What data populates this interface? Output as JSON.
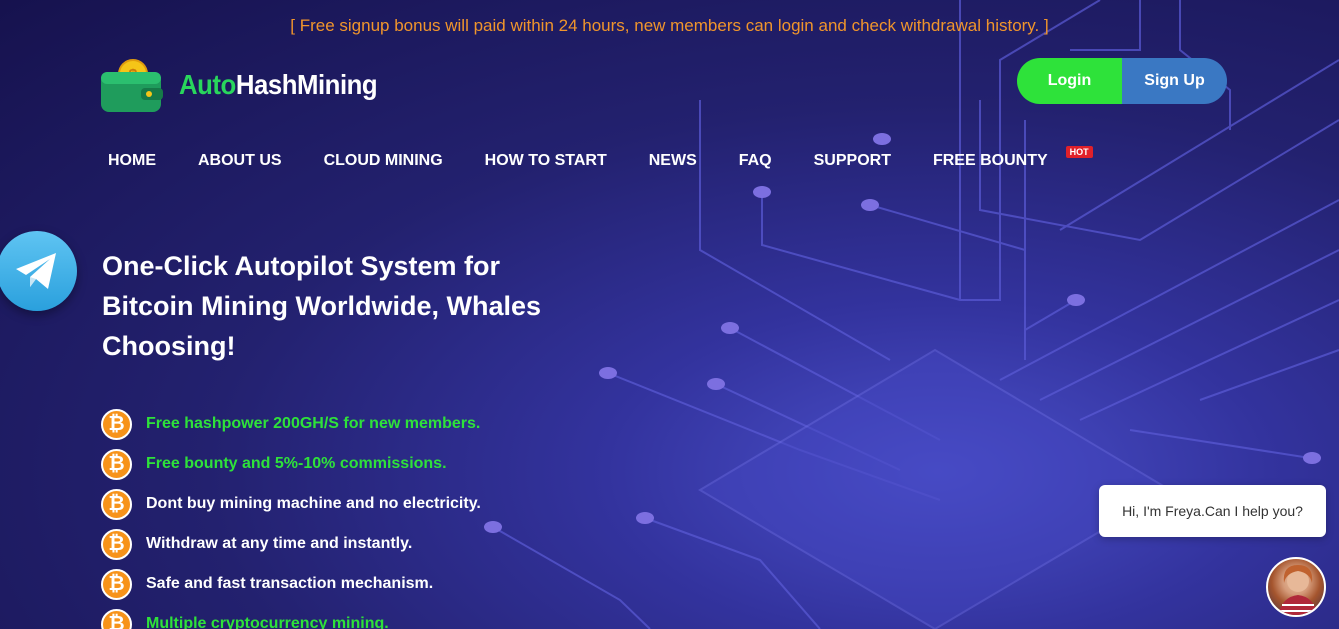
{
  "announcement": "[ Free signup bonus will paid within 24 hours, new members can login and check withdrawal history. ]",
  "brand": {
    "part1": "Auto",
    "part2": "HashMining",
    "logo_icon": "wallet-coin-icon"
  },
  "auth": {
    "login_label": "Login",
    "signup_label": "Sign Up"
  },
  "nav": {
    "items": [
      {
        "label": "HOME"
      },
      {
        "label": "ABOUT US"
      },
      {
        "label": "CLOUD MINING"
      },
      {
        "label": "HOW TO START"
      },
      {
        "label": "NEWS"
      },
      {
        "label": "FAQ"
      },
      {
        "label": "SUPPORT"
      },
      {
        "label": "FREE BOUNTY",
        "badge": "HOT"
      }
    ]
  },
  "hero": {
    "title": "One-Click Autopilot System for Bitcoin Mining Worldwide, Whales Choosing!",
    "features": [
      {
        "text": "Free hashpower 200GH/S for new members.",
        "color": "#2ee23a"
      },
      {
        "text": "Free bounty and 5%-10% commissions.",
        "color": "#2ee23a"
      },
      {
        "text": "Dont buy mining machine and no electricity.",
        "color": "#ffffff"
      },
      {
        "text": "Withdraw at any time and instantly.",
        "color": "#ffffff"
      },
      {
        "text": "Safe and fast transaction mechanism.",
        "color": "#ffffff"
      },
      {
        "text": "Multiple cryptocurrency mining.",
        "color": "#2ee23a"
      }
    ]
  },
  "chat": {
    "message": "Hi, I'm Freya.Can I help you?"
  },
  "colors": {
    "accent_green": "#2ee23a",
    "accent_blue": "#3a78c3",
    "announcement": "#f0952c",
    "bitcoin": "#f7931a"
  }
}
